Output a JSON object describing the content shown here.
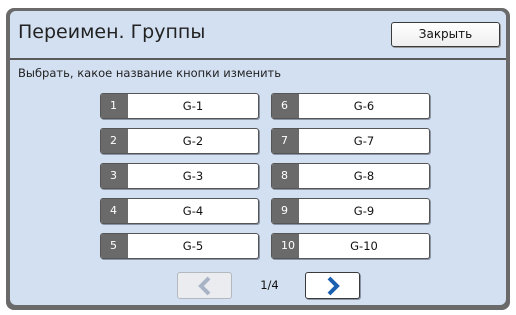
{
  "header": {
    "title": "Переимен. Группы",
    "close_label": "Закрыть"
  },
  "instruction": "Выбрать, какое название кнопки изменить",
  "groups": [
    {
      "num": "1",
      "name": "G-1"
    },
    {
      "num": "2",
      "name": "G-2"
    },
    {
      "num": "3",
      "name": "G-3"
    },
    {
      "num": "4",
      "name": "G-4"
    },
    {
      "num": "5",
      "name": "G-5"
    },
    {
      "num": "6",
      "name": "G-6"
    },
    {
      "num": "7",
      "name": "G-7"
    },
    {
      "num": "8",
      "name": "G-8"
    },
    {
      "num": "9",
      "name": "G-9"
    },
    {
      "num": "10",
      "name": "G-10"
    }
  ],
  "pagination": {
    "indicator": "1/4",
    "prev_icon": "chevron-left-icon",
    "next_icon": "chevron-right-icon",
    "accent_color": "#1a5fb0",
    "disabled_color": "#a8b4c6"
  }
}
